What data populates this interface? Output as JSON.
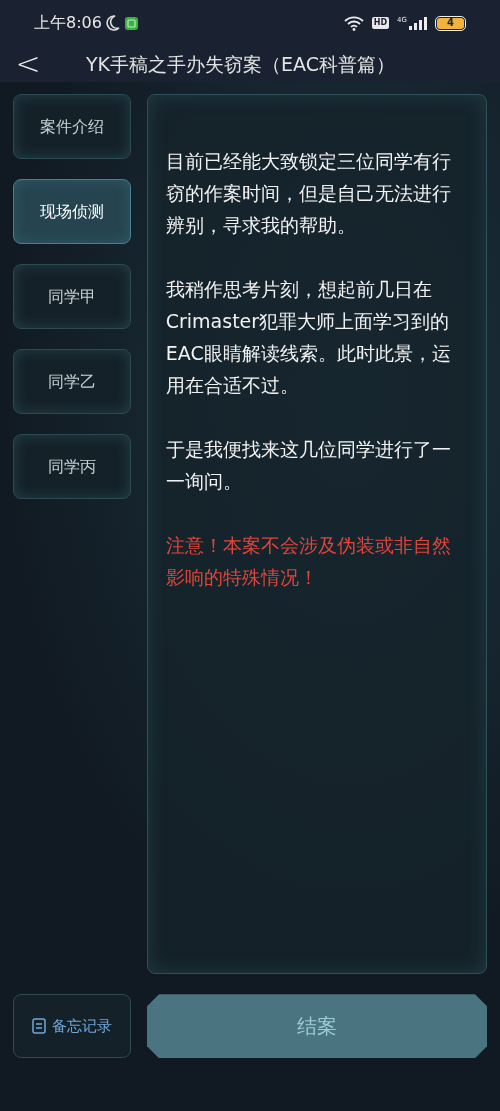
{
  "status_bar": {
    "time": "上午8:06",
    "hd_label": "HD",
    "network": "4G",
    "battery": "4"
  },
  "header": {
    "back": "<",
    "title": "YK手稿之手办失窃案（EAC科普篇）"
  },
  "sidebar": {
    "items": [
      {
        "label": "案件介绍",
        "selected": false
      },
      {
        "label": "现场侦测",
        "selected": true
      },
      {
        "label": "同学甲",
        "selected": false
      },
      {
        "label": "同学乙",
        "selected": false
      },
      {
        "label": "同学丙",
        "selected": false
      }
    ]
  },
  "content": {
    "paragraphs": [
      {
        "kind": "normal",
        "text": "目前已经能大致锁定三位同学有行窃的作案时间，但是自己无法进行辨别，寻求我的帮助。"
      },
      {
        "kind": "normal",
        "text": "我稍作思考片刻，想起前几日在Crimaster犯罪大师上面学习到的EAC眼睛解读线索。此时此景，运用在合适不过。"
      },
      {
        "kind": "normal",
        "text": "于是我便找来这几位同学进行了一一询问。"
      },
      {
        "kind": "warning",
        "text": "注意！本案不会涉及伪装或非自然影响的特殊情况！"
      }
    ]
  },
  "footer": {
    "memo_button": "备忘记录",
    "close_case_button": "结案"
  }
}
